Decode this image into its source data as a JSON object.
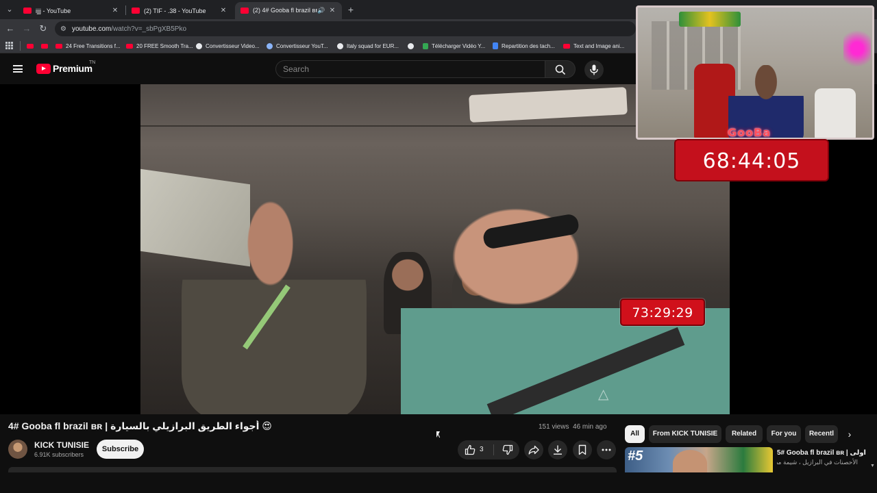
{
  "browser": {
    "tabs": [
      {
        "label": "ijjj - YouTube"
      },
      {
        "label": "(2) TIF - .38 - YouTube"
      },
      {
        "label": "(2) 4# Gooba fl brazil ʙʀ | أ"
      }
    ],
    "url": {
      "host": "youtube.com",
      "path": "/watch?v=_sbPgXB5Pko"
    },
    "bookmarks": [
      {
        "label": "",
        "icon": "youtube-icon"
      },
      {
        "label": "",
        "icon": "youtube-icon"
      },
      {
        "label": "24 Free Transitions f...",
        "icon": "youtube-icon"
      },
      {
        "label": "20 FREE Smooth Tra...",
        "icon": "youtube-icon"
      },
      {
        "label": "Convertisseur Video...",
        "icon": "google-icon"
      },
      {
        "label": "Convertisseur YouT...",
        "icon": "converter-icon"
      },
      {
        "label": "Italy squad for EUR...",
        "icon": "globe-icon"
      },
      {
        "label": "",
        "icon": "globe-icon"
      },
      {
        "label": "Télécharger Vidéo Y...",
        "icon": "download-icon"
      },
      {
        "label": "Repartition des tach...",
        "icon": "docs-icon"
      },
      {
        "label": "Text and Image ani...",
        "icon": "youtube-icon"
      }
    ]
  },
  "masthead": {
    "logo_text": "Premium",
    "region_code": "TN",
    "search_placeholder": "Search"
  },
  "player": {
    "video_timer": "73:29:29",
    "cam_name": "GooBa",
    "cam_timer": "68:44:05"
  },
  "video": {
    "title": "4# Gooba fl brazil ʙʀ | أجواء الطريق البرازيلي بالسيارة 😍",
    "views": "151 views",
    "age": "46 min ago",
    "channel": {
      "name": "KICK TUNISIE",
      "subscribers": "6.91K subscribers"
    },
    "subscribe_label": "Subscribe",
    "like_count": "3"
  },
  "chips": [
    {
      "label": "All",
      "selected": true
    },
    {
      "label": "From KICK TUNISIE"
    },
    {
      "label": "Related"
    },
    {
      "label": "For you"
    },
    {
      "label": "Recentl"
    }
  ],
  "recommendation": {
    "thumb_number": "#5",
    "title": "5# Gooba fl brazil ʙʀ | اولى",
    "subtitle": "الأحصنات في البرازيل ، شيمة مضحكة"
  },
  "colors": {
    "youtube_red": "#ff0033",
    "timer_red": "#c4101c",
    "background": "#0f0f0f"
  }
}
